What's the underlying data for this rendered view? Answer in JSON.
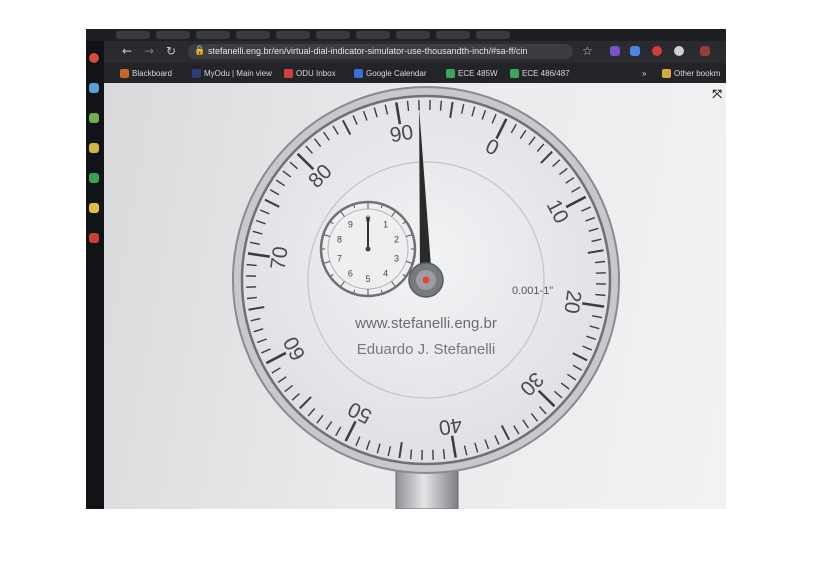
{
  "browser": {
    "address_bar": {
      "url": "stefanelli.eng.br/en/virtual-dial-indicator-simulator-use-thousandth-inch/#sa-ff/cin"
    },
    "bookmarks": [
      {
        "label": "Blackboard",
        "icon": "blackboard-icon",
        "color": "#c9652a"
      },
      {
        "label": "MyOdu | Main view",
        "icon": "odu-icon",
        "color": "#2b3f7a"
      },
      {
        "label": "ODU Inbox",
        "icon": "mail-icon",
        "color": "#d04040"
      },
      {
        "label": "Google Calendar",
        "icon": "calendar-icon",
        "color": "#3b6fd8"
      },
      {
        "label": "ECE 485W",
        "icon": "google-drive-icon",
        "color": "#3ba55d"
      },
      {
        "label": "ECE 486/487",
        "icon": "google-drive-icon",
        "color": "#3ba55d"
      },
      {
        "label": "Other bookm",
        "icon": "folder-icon",
        "color": "#d7a93c"
      }
    ],
    "overflow_label": "»"
  },
  "dial": {
    "main_labels": [
      "0",
      "10",
      "20",
      "30",
      "40",
      "50",
      "60",
      "70",
      "80",
      "90"
    ],
    "revolution_labels": [
      "0",
      "1",
      "2",
      "3",
      "4",
      "5",
      "6",
      "7",
      "8",
      "9"
    ],
    "resolution_text": "0.001-1\"",
    "website_text": "www.stefanelli.eng.br",
    "author_text": "Eduardo J. Stefanelli",
    "main_reading": 92,
    "revolution_reading": 0,
    "needle_color": "#2a2a2a",
    "center_cap_color": "#e0473c"
  }
}
